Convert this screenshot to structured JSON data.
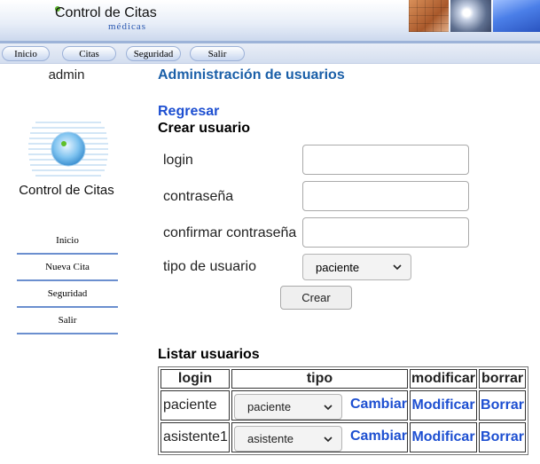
{
  "header": {
    "logo_title": "Control de Citas",
    "logo_subtitle": "médicas"
  },
  "topnav": {
    "items": [
      {
        "label": "Inicio"
      },
      {
        "label": "Citas"
      },
      {
        "label": "Seguridad"
      },
      {
        "label": "Salir"
      }
    ]
  },
  "sidebar": {
    "username": "admin",
    "title": "Control de Citas",
    "items": [
      {
        "label": "Inicio"
      },
      {
        "label": "Nueva Cita"
      },
      {
        "label": "Seguridad"
      },
      {
        "label": "Salir"
      }
    ]
  },
  "main": {
    "heading": "Administración de usuarios",
    "back_link": "Regresar",
    "create": {
      "title": "Crear usuario",
      "login_label": "login",
      "password_label": "contraseña",
      "confirm_label": "confirmar contraseña",
      "type_label": "tipo de usuario",
      "type_value": "paciente",
      "login_value": "",
      "password_value": "",
      "confirm_value": "",
      "submit_label": "Crear"
    },
    "list": {
      "title": "Listar usuarios",
      "columns": [
        "login",
        "tipo",
        "modificar",
        "borrar"
      ],
      "rows": [
        {
          "login": "paciente",
          "tipo": "paciente",
          "cambiar": "Cambiar",
          "modificar": "Modificar",
          "borrar": "Borrar"
        },
        {
          "login": "asistente1",
          "tipo": "asistente",
          "cambiar": "Cambiar",
          "modificar": "Modificar",
          "borrar": "Borrar"
        }
      ]
    }
  },
  "icons": {
    "dropdown": "chevron-down-icon",
    "logo": "globe-logo-icon"
  },
  "colors": {
    "link": "#1d4fd1",
    "heading": "#1a5fa8",
    "sidebar_divider": "#6b8fcf"
  }
}
